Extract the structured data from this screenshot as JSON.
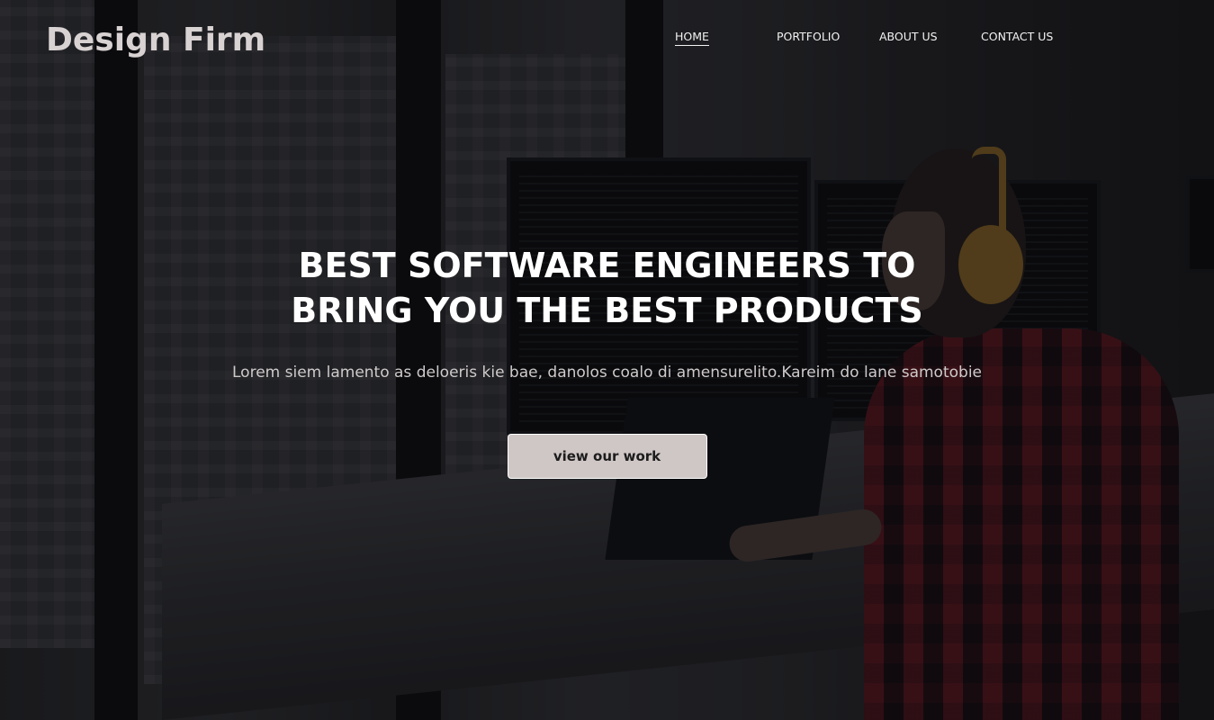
{
  "brand": {
    "name": "Design Firm"
  },
  "nav": {
    "items": [
      {
        "label": "HOME",
        "active": true
      },
      {
        "label": "PORTFOLIO",
        "active": false
      },
      {
        "label": "ABOUT US",
        "active": false
      },
      {
        "label": "CONTACT US",
        "active": false
      }
    ]
  },
  "hero": {
    "title_line1": "BEST SOFTWARE ENGINEERS TO",
    "title_line2": "BRING YOU THE BEST PRODUCTS",
    "subtitle": "Lorem siem lamento as deloeris kie bae, danolos coalo di amensurelito.Kareim do lane samotobie",
    "cta_label": "view our work",
    "background_image": "person-with-headphones-at-desk-with-monitors-photo"
  },
  "colors": {
    "brand_text": "#d8d2d2",
    "nav_text": "#f2f2f2",
    "title_text": "#ffffff",
    "subtitle_text": "#cfcaca",
    "button_bg": "#cfc6c6",
    "button_text": "#1c1c1c"
  }
}
